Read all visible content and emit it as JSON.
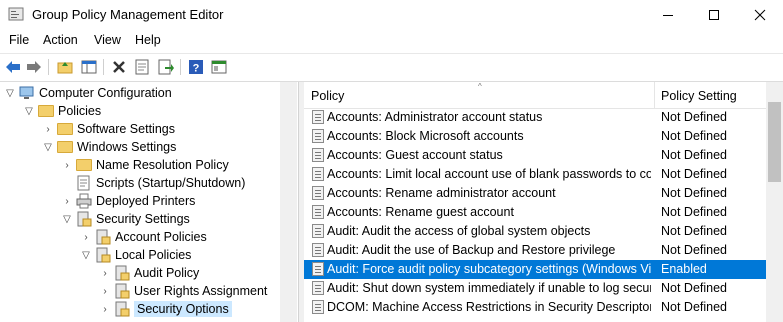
{
  "window": {
    "title": "Group Policy Management Editor"
  },
  "menu": [
    "File",
    "Action",
    "View",
    "Help"
  ],
  "toolbar_icons": [
    "back-arrow-icon",
    "forward-arrow-icon",
    "up-folder-icon",
    "show-hide-tree-icon",
    "delete-icon",
    "properties-icon",
    "export-icon",
    "help-icon",
    "console-icon"
  ],
  "tree": [
    {
      "label": "Computer Configuration",
      "expanded": true
    },
    {
      "label": "Policies",
      "expanded": true
    },
    {
      "label": "Software Settings",
      "expanded": false
    },
    {
      "label": "Windows Settings",
      "expanded": true
    },
    {
      "label": "Name Resolution Policy",
      "expanded": false
    },
    {
      "label": "Scripts (Startup/Shutdown)"
    },
    {
      "label": "Deployed Printers",
      "expanded": false
    },
    {
      "label": "Security Settings",
      "expanded": true
    },
    {
      "label": "Account Policies",
      "expanded": false
    },
    {
      "label": "Local Policies",
      "expanded": true
    },
    {
      "label": "Audit Policy",
      "expanded": false
    },
    {
      "label": "User Rights Assignment",
      "expanded": false
    },
    {
      "label": "Security Options",
      "expanded": false,
      "selected": true
    }
  ],
  "columns": {
    "policy": "Policy",
    "setting": "Policy Setting"
  },
  "rows": [
    {
      "policy": "Accounts: Administrator account status",
      "setting": "Not Defined"
    },
    {
      "policy": "Accounts: Block Microsoft accounts",
      "setting": "Not Defined"
    },
    {
      "policy": "Accounts: Guest account status",
      "setting": "Not Defined"
    },
    {
      "policy": "Accounts: Limit local account use of blank passwords to co...",
      "setting": "Not Defined"
    },
    {
      "policy": "Accounts: Rename administrator account",
      "setting": "Not Defined"
    },
    {
      "policy": "Accounts: Rename guest account",
      "setting": "Not Defined"
    },
    {
      "policy": "Audit: Audit the access of global system objects",
      "setting": "Not Defined"
    },
    {
      "policy": "Audit: Audit the use of Backup and Restore privilege",
      "setting": "Not Defined"
    },
    {
      "policy": "Audit: Force audit policy subcategory settings (Windows Vis...",
      "setting": "Enabled",
      "selected": true
    },
    {
      "policy": "Audit: Shut down system immediately if unable to log secur...",
      "setting": "Not Defined"
    },
    {
      "policy": "DCOM: Machine Access Restrictions in Security Descriptor D...",
      "setting": "Not Defined"
    }
  ],
  "colors": {
    "selection": "#0078d7",
    "tree_selection": "#cce8ff",
    "folder": "#f3cf6b"
  }
}
